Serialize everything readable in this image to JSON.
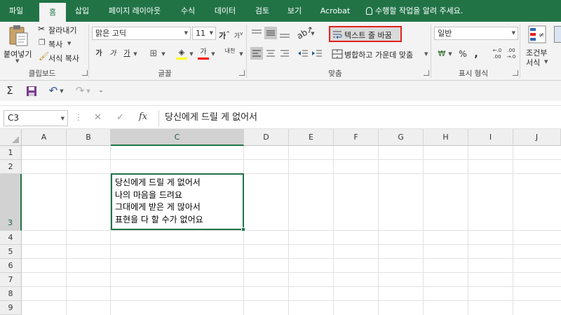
{
  "tabs": [
    "파일",
    "홈",
    "삽입",
    "페이지 레이아웃",
    "수식",
    "데이터",
    "검토",
    "보기",
    "Acrobat"
  ],
  "active_tab": "홈",
  "tell_me": "수행할 작업을 알려 주세요.",
  "clipboard": {
    "paste": "붙여넣기",
    "cut": "잘라내기",
    "copy": "복사",
    "format_painter": "서식 복사",
    "label": "클립보드"
  },
  "font": {
    "name": "맑은 고딕",
    "size": "11",
    "grow": "가",
    "shrink": "가",
    "bold": "가",
    "italic": "가",
    "underline": "가",
    "font_color": "가",
    "phonetic": "내천",
    "label": "글꼴"
  },
  "alignment": {
    "wrap_text": "텍스트 줄 바꿈",
    "merge_center": "병합하고 가운데 맞춤",
    "label": "맞춤"
  },
  "number": {
    "format": "일반",
    "label": "표시 형식"
  },
  "styles": {
    "conditional": "조건부",
    "conditional_2": "서식"
  },
  "colors": {
    "excel_green": "#217346",
    "highlight_red": "#e2211c",
    "fill_yellow": "#ffff00",
    "font_red": "#ff0000"
  },
  "formula_bar": {
    "name_box": "C3",
    "cancel": "✕",
    "enter": "✓",
    "fx": "fx",
    "value": "당신에게 드릴 게 없어서"
  },
  "columns": [
    "A",
    "B",
    "C",
    "D",
    "E",
    "F",
    "G",
    "H",
    "I",
    "J"
  ],
  "rows": [
    "1",
    "2",
    "3",
    "4",
    "5",
    "6",
    "7",
    "8",
    "9"
  ],
  "selected_cell": "C3",
  "cell_c3_lines": [
    "당신에게 드릴 게 없어서",
    "나의 마음을 드려요",
    "그대에게 받은 게 많아서",
    "표현을 다 할 수가 없어요"
  ]
}
